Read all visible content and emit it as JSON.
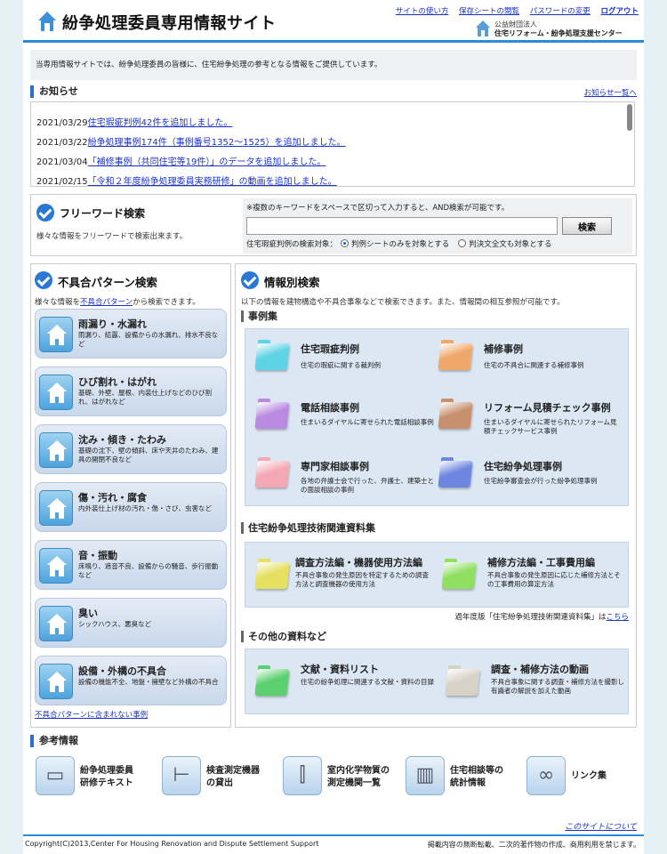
{
  "header": {
    "site_title": "紛争処理委員専用情報サイト",
    "links": [
      "サイトの使い方",
      "保存シートの閲覧",
      "パスワードの変更"
    ],
    "logout": "ログアウト",
    "org_line1": "公益財団法人",
    "org_line2": "住宅リフォーム・紛争処理支援センター"
  },
  "intro": "当専用情報サイトでは、紛争処理委員の皆様に、住宅紛争処理の参考となる情報をご提供しています。",
  "news": {
    "title": "お知らせ",
    "more": "お知らせ一覧へ",
    "items": [
      {
        "date": "2021/03/29",
        "text": "住宅瑕疵判例42件を追加しました。"
      },
      {
        "date": "2021/03/22",
        "text": "紛争処理事例174件（事例番号1352〜1525）を追加しました。"
      },
      {
        "date": "2021/03/04",
        "text": "「補修事例（共同住宅等19件）」のデータを追加しました。"
      },
      {
        "date": "2021/02/15",
        "text": "「令和２年度紛争処理委員実務研修」の動画を追加しました。"
      }
    ]
  },
  "free_word": {
    "title": "フリーワード検索",
    "desc": "様々な情報をフリーワードで検索出来ます。",
    "note": "※複数のキーワードをスペースで区切って入力すると、AND検索が可能です。",
    "input_value": "",
    "button": "検索",
    "target_label": "住宅瑕疵判例の検索対象：",
    "option1": "判例シートのみを対象とする",
    "option2": "判決文全文も対象とする",
    "selected": "option1"
  },
  "pattern": {
    "title": "不具合パターン検索",
    "desc_before": "様々な情報を",
    "desc_link": "不具合パターン",
    "desc_after": "から検索できます。",
    "items": [
      {
        "title": "雨漏り・水漏れ",
        "desc": "雨漏り、結露、設備からの水漏れ、排水不良など"
      },
      {
        "title": "ひび割れ・はがれ",
        "desc": "基礎、外壁、屋根、内装仕上げなどのひび割れ、はがれなど"
      },
      {
        "title": "沈み・傾き・たわみ",
        "desc": "基礎の沈下、壁の傾斜、床や天井のたわみ、建具の開閉不良など"
      },
      {
        "title": "傷・汚れ・腐食",
        "desc": "内外装仕上げ材の汚れ・傷・さび、虫害など"
      },
      {
        "title": "音・振動",
        "desc": "床鳴り、遮音不良、設備からの騒音、歩行振動など"
      },
      {
        "title": "臭い",
        "desc": "シックハウス、悪臭など"
      },
      {
        "title": "設備・外構の不具合",
        "desc": "設備の機能不全、地盤・擁壁など外構の不具合"
      }
    ],
    "extra_link": "不具合パターンに含まれない事例"
  },
  "info": {
    "title": "情報別検索",
    "desc": "以下の情報を建物構造や不具合事象などで検索できます。また、情報間の相互参照が可能です。",
    "cases_head": "事例集",
    "cases": [
      {
        "title": "住宅瑕疵判例",
        "desc": "住宅の瑕疵に関する裁判例",
        "color": "#5fd3e6"
      },
      {
        "title": "補修事例",
        "desc": "住宅の不具合に関連する補修事例",
        "color": "#f0a86a"
      },
      {
        "title": "電話相談事例",
        "desc": "住まいるダイヤルに寄せられた電話相談事例",
        "color": "#b98ae0"
      },
      {
        "title": "リフォーム見積チェック事例",
        "desc": "住まいるダイヤルに寄せられたリフォーム見積チェックサービス事例",
        "color": "#c99070"
      },
      {
        "title": "専門家相談事例",
        "desc": "各地の弁護士会で行った、弁護士、建築士との面談相談の事例",
        "color": "#f4a8b4"
      },
      {
        "title": "住宅紛争処理事例",
        "desc": "住宅紛争審査会が行った紛争処理事例",
        "color": "#6d86e0"
      }
    ],
    "tech_head": "住宅紛争処理技術関連資料集",
    "tech": [
      {
        "title": "調査方法編・機器使用方法編",
        "desc": "不具合事象の発生原因を特定するための調査方法と調査機器の使用方法",
        "color": "#e6e060"
      },
      {
        "title": "補修方法編・工事費用編",
        "desc": "不具合事象の発生原因に応じた補修方法とその工事費用の算定方法",
        "color": "#8fe060"
      }
    ],
    "past_note": "過年度版「住宅紛争処理技術関連資料集」は",
    "past_link": "こちら",
    "other_head": "その他の資料など",
    "other": [
      {
        "title": "文献・資料リスト",
        "desc": "住宅の紛争処理に関連する文献・資料の目録",
        "color": "#5cd070"
      },
      {
        "title": "調査・補修方法の動画",
        "desc": "不具合事象に関する調査・補修方法を撮影し有識者の解説を加えた動画",
        "color": "#d8d2c6"
      }
    ]
  },
  "reference": {
    "title": "参考情報",
    "items": [
      {
        "line1": "紛争処理委員",
        "line2": "研修テキスト",
        "icon": "book-icon"
      },
      {
        "line1": "検査測定機器",
        "line2": "の貸出",
        "icon": "caliper-icon"
      },
      {
        "line1": "室内化学物質の",
        "line2": "測定機関一覧",
        "icon": "test-tube-icon"
      },
      {
        "line1": "住宅相談等の",
        "line2": "統計情報",
        "icon": "bar-chart-icon"
      },
      {
        "line1": "リンク集",
        "line2": "",
        "icon": "link-icon"
      }
    ]
  },
  "about": "このサイトについて",
  "footer": {
    "copyright": "Copyright(C)2013,Center For Housing Renovation and Dispute Settlement Support",
    "note": "掲載内容の無断転載、二次的著作物の作成、商用利用を禁じます。"
  }
}
